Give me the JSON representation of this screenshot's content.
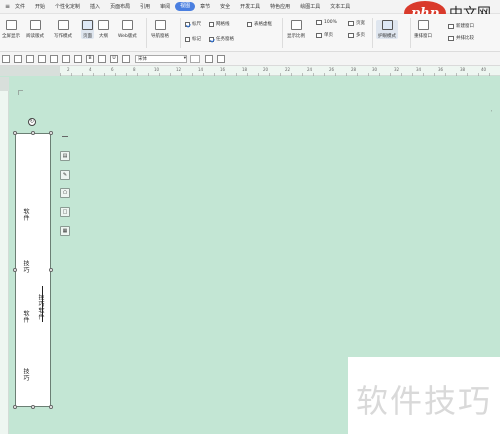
{
  "menubar": {
    "items": [
      "文件",
      "开始",
      "个性化定制",
      "插入",
      "页面布局",
      "引用",
      "审阅",
      "视图",
      "章节",
      "安全",
      "开发工具",
      "特色应用",
      "绘图工具",
      "文本工具"
    ],
    "active_index": 7
  },
  "ribbon": {
    "buttons": [
      "全屏显示",
      "阅读版式",
      "写作模式",
      "页面",
      "大纲",
      "Web版式",
      "导航窗格",
      "显示比例",
      "100%",
      "页宽",
      "护眼模式",
      "重排窗口",
      "新建窗口",
      "并排比较"
    ],
    "checks": [
      {
        "label": "标尺",
        "checked": true
      },
      {
        "label": "网格线",
        "checked": false
      },
      {
        "label": "表格虚框",
        "checked": false
      },
      {
        "label": "标记",
        "checked": false
      },
      {
        "label": "任务窗格",
        "checked": true
      }
    ],
    "small": [
      "单页",
      "多页"
    ]
  },
  "format": {
    "font": "宋体",
    "bold": "B",
    "underline": "U"
  },
  "ruler": {
    "numbers": [
      "2",
      "4",
      "6",
      "8",
      "10",
      "12",
      "14",
      "16",
      "18",
      "20",
      "22",
      "24",
      "26",
      "28",
      "30",
      "32",
      "34",
      "36",
      "38",
      "40"
    ]
  },
  "textbox": {
    "col_left": [
      "软件",
      "技巧",
      "软件",
      "技巧"
    ],
    "col_right": "技巧软件"
  },
  "watermark": "软件技巧",
  "logo": {
    "mark": "php",
    "text": "中文网"
  },
  "colors": {
    "page_background": "#c3e6d4",
    "accent": "#4a7fe0",
    "logo_red": "#d93a2b"
  }
}
